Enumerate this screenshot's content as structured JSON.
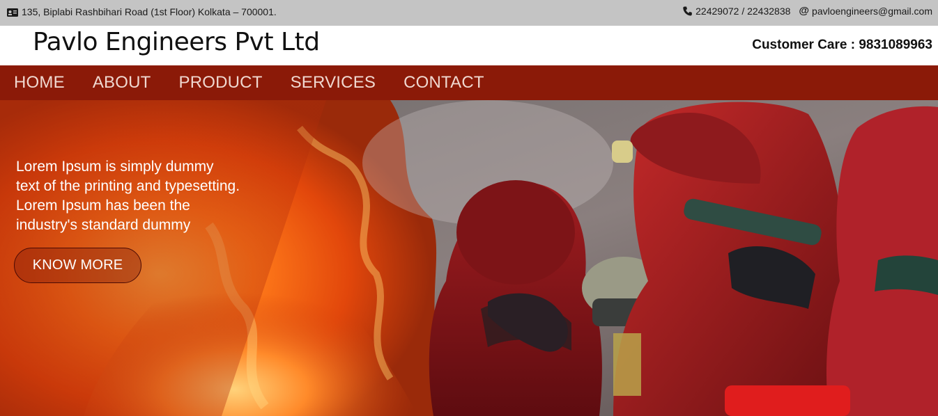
{
  "topbar": {
    "address": "135, Biplabi Rashbihari Road (1st Floor) Kolkata – 700001.",
    "phones": "22429072 / 22432838",
    "email": "pavloengineers@gmail.com",
    "address_icon": "id-card-icon",
    "phone_icon": "phone-icon",
    "email_icon": "at-icon"
  },
  "header": {
    "brand": "Pavlo Engineers Pvt Ltd",
    "customer_care": "Customer Care : 9831089963"
  },
  "nav": {
    "items": [
      "HOME",
      "ABOUT",
      "PRODUCT",
      "SERVICES",
      "CONTACT"
    ]
  },
  "hero": {
    "lines": [
      "Lorem Ipsum is simply dummy",
      "text of the printing and typesetting.",
      "Lorem Ipsum has been the",
      "industry's standard dummy"
    ],
    "cta_label": "KNOW MORE"
  },
  "colors": {
    "topbar_bg": "#c4c4c4",
    "nav_bg": "#8b1a08",
    "nav_text": "#f0d8d0",
    "brand_text": "#111111"
  }
}
